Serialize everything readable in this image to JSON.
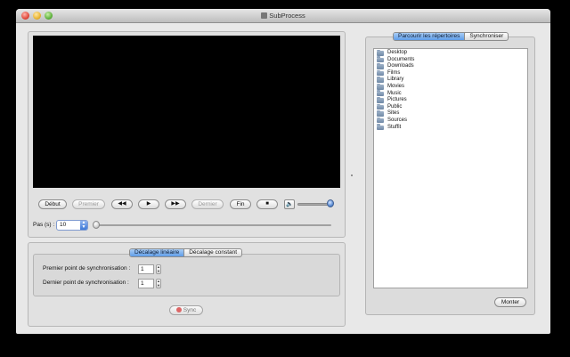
{
  "window": {
    "title": "SubProcess",
    "title_icon": "app-icon"
  },
  "player": {
    "buttons": {
      "debut": "Début",
      "premier": "Premier",
      "rewind": "◀◀",
      "play": "▶",
      "forward": "▶▶",
      "dernier": "Dernier",
      "fin": "Fin",
      "stop": "■"
    },
    "speaker_glyph": "🔈",
    "volume_level": 0.9
  },
  "step": {
    "label": "Pas (s) :",
    "value": "10",
    "slider_level": 0.0
  },
  "sync": {
    "tabs": [
      {
        "label": "Décalage linéaire",
        "active": true
      },
      {
        "label": "Décalage constant",
        "active": false
      }
    ],
    "first_point_label": "Premier point de synchronisation :",
    "first_point_value": "1",
    "last_point_label": "Dernier point de synchronisation :",
    "last_point_value": "1",
    "sync_button": "Sync"
  },
  "browser": {
    "tabs": [
      {
        "label": "Parcourir les répertoires",
        "active": true
      },
      {
        "label": "Synchroniser",
        "active": false
      }
    ],
    "items": [
      "Desktop",
      "Documents",
      "Downloads",
      "Films",
      "Library",
      "Movies",
      "Music",
      "Pictures",
      "Public",
      "Sites",
      "Sources",
      "Stuffit"
    ],
    "up_button": "Monter"
  },
  "colors": {
    "accent": "#5f9de7",
    "window_bg": "#e8e8e8",
    "video_bg": "#000000"
  }
}
